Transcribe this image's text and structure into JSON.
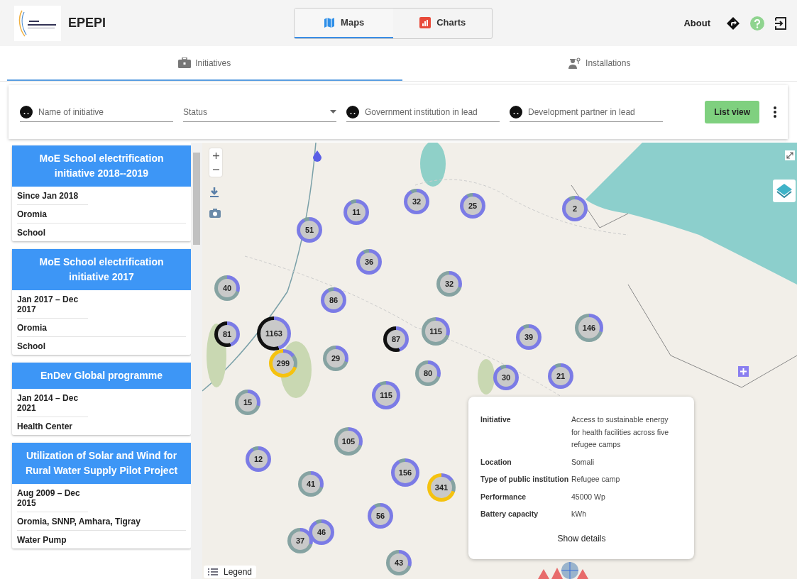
{
  "header": {
    "title": "EPEPI",
    "nav_tabs": [
      {
        "label": "Maps",
        "selected": true
      },
      {
        "label": "Charts",
        "selected": false
      }
    ],
    "about": "About"
  },
  "sub_tabs": [
    {
      "label": "Initiatives",
      "selected": true
    },
    {
      "label": "Installations",
      "selected": false
    }
  ],
  "filters": {
    "fields": [
      {
        "kind": "search",
        "placeholder": "Name of initiative"
      },
      {
        "kind": "select",
        "placeholder": "Status"
      },
      {
        "kind": "search",
        "placeholder": "Government institution in lead"
      },
      {
        "kind": "search",
        "placeholder": "Development partner in lead"
      }
    ],
    "button": "List view"
  },
  "initiatives": [
    {
      "title": "MoE School electrification initiative 2018--2019",
      "lines": [
        "Since Jan 2018",
        "Oromia",
        "School"
      ]
    },
    {
      "title": "MoE School electrification initiative 2017",
      "lines": [
        "Jan 2017 – Dec 2017",
        "Oromia",
        "School"
      ]
    },
    {
      "title": "EnDev Global programme",
      "lines": [
        "Jan 2014 – Dec 2021",
        "Health Center"
      ]
    },
    {
      "title": "Utilization of Solar and Wind for Rural Water Supply Pilot Project",
      "lines": [
        "Aug 2009 – Dec 2015",
        "Oromia, SNNP, Amhara, Tigray",
        "Water Pump"
      ]
    }
  ],
  "map": {
    "clusters": [
      {
        "count": "11",
        "kind": "blue"
      },
      {
        "count": "32",
        "kind": "blue"
      },
      {
        "count": "25",
        "kind": "blue"
      },
      {
        "count": "2",
        "kind": "blue"
      },
      {
        "count": "51",
        "kind": "blue"
      },
      {
        "count": "36",
        "kind": "blue"
      },
      {
        "count": "40",
        "kind": "gray"
      },
      {
        "count": "86",
        "kind": "blue"
      },
      {
        "count": "32",
        "kind": "gray"
      },
      {
        "count": "81",
        "kind": "black"
      },
      {
        "count": "1163",
        "kind": "black"
      },
      {
        "count": "87",
        "kind": "black"
      },
      {
        "count": "115",
        "kind": "gray"
      },
      {
        "count": "39",
        "kind": "blue"
      },
      {
        "count": "146",
        "kind": "gray"
      },
      {
        "count": "299",
        "kind": "yellow"
      },
      {
        "count": "29",
        "kind": "gray"
      },
      {
        "count": "80",
        "kind": "gray"
      },
      {
        "count": "30",
        "kind": "blue"
      },
      {
        "count": "21",
        "kind": "blue"
      },
      {
        "count": "15",
        "kind": "gray"
      },
      {
        "count": "115",
        "kind": "blue"
      },
      {
        "count": "105",
        "kind": "gray"
      },
      {
        "count": "12",
        "kind": "blue"
      },
      {
        "count": "156",
        "kind": "blue"
      },
      {
        "count": "41",
        "kind": "gray"
      },
      {
        "count": "341",
        "kind": "yellow"
      },
      {
        "count": "56",
        "kind": "blue"
      },
      {
        "count": "37",
        "kind": "gray"
      },
      {
        "count": "46",
        "kind": "blue"
      },
      {
        "count": "43",
        "kind": "gray"
      }
    ],
    "popup": {
      "rows": [
        {
          "label": "Initiative",
          "value": "Access to sustainable energy for health facilities across five refugee camps"
        },
        {
          "label": "Location",
          "value": "Somali"
        },
        {
          "label": "Type of public institution",
          "value": "Refugee camp"
        },
        {
          "label": "Performance",
          "value": "45000 Wp"
        },
        {
          "label": "Battery capacity",
          "value": "kWh"
        }
      ],
      "button": "Show details"
    },
    "legend": "Legend"
  }
}
